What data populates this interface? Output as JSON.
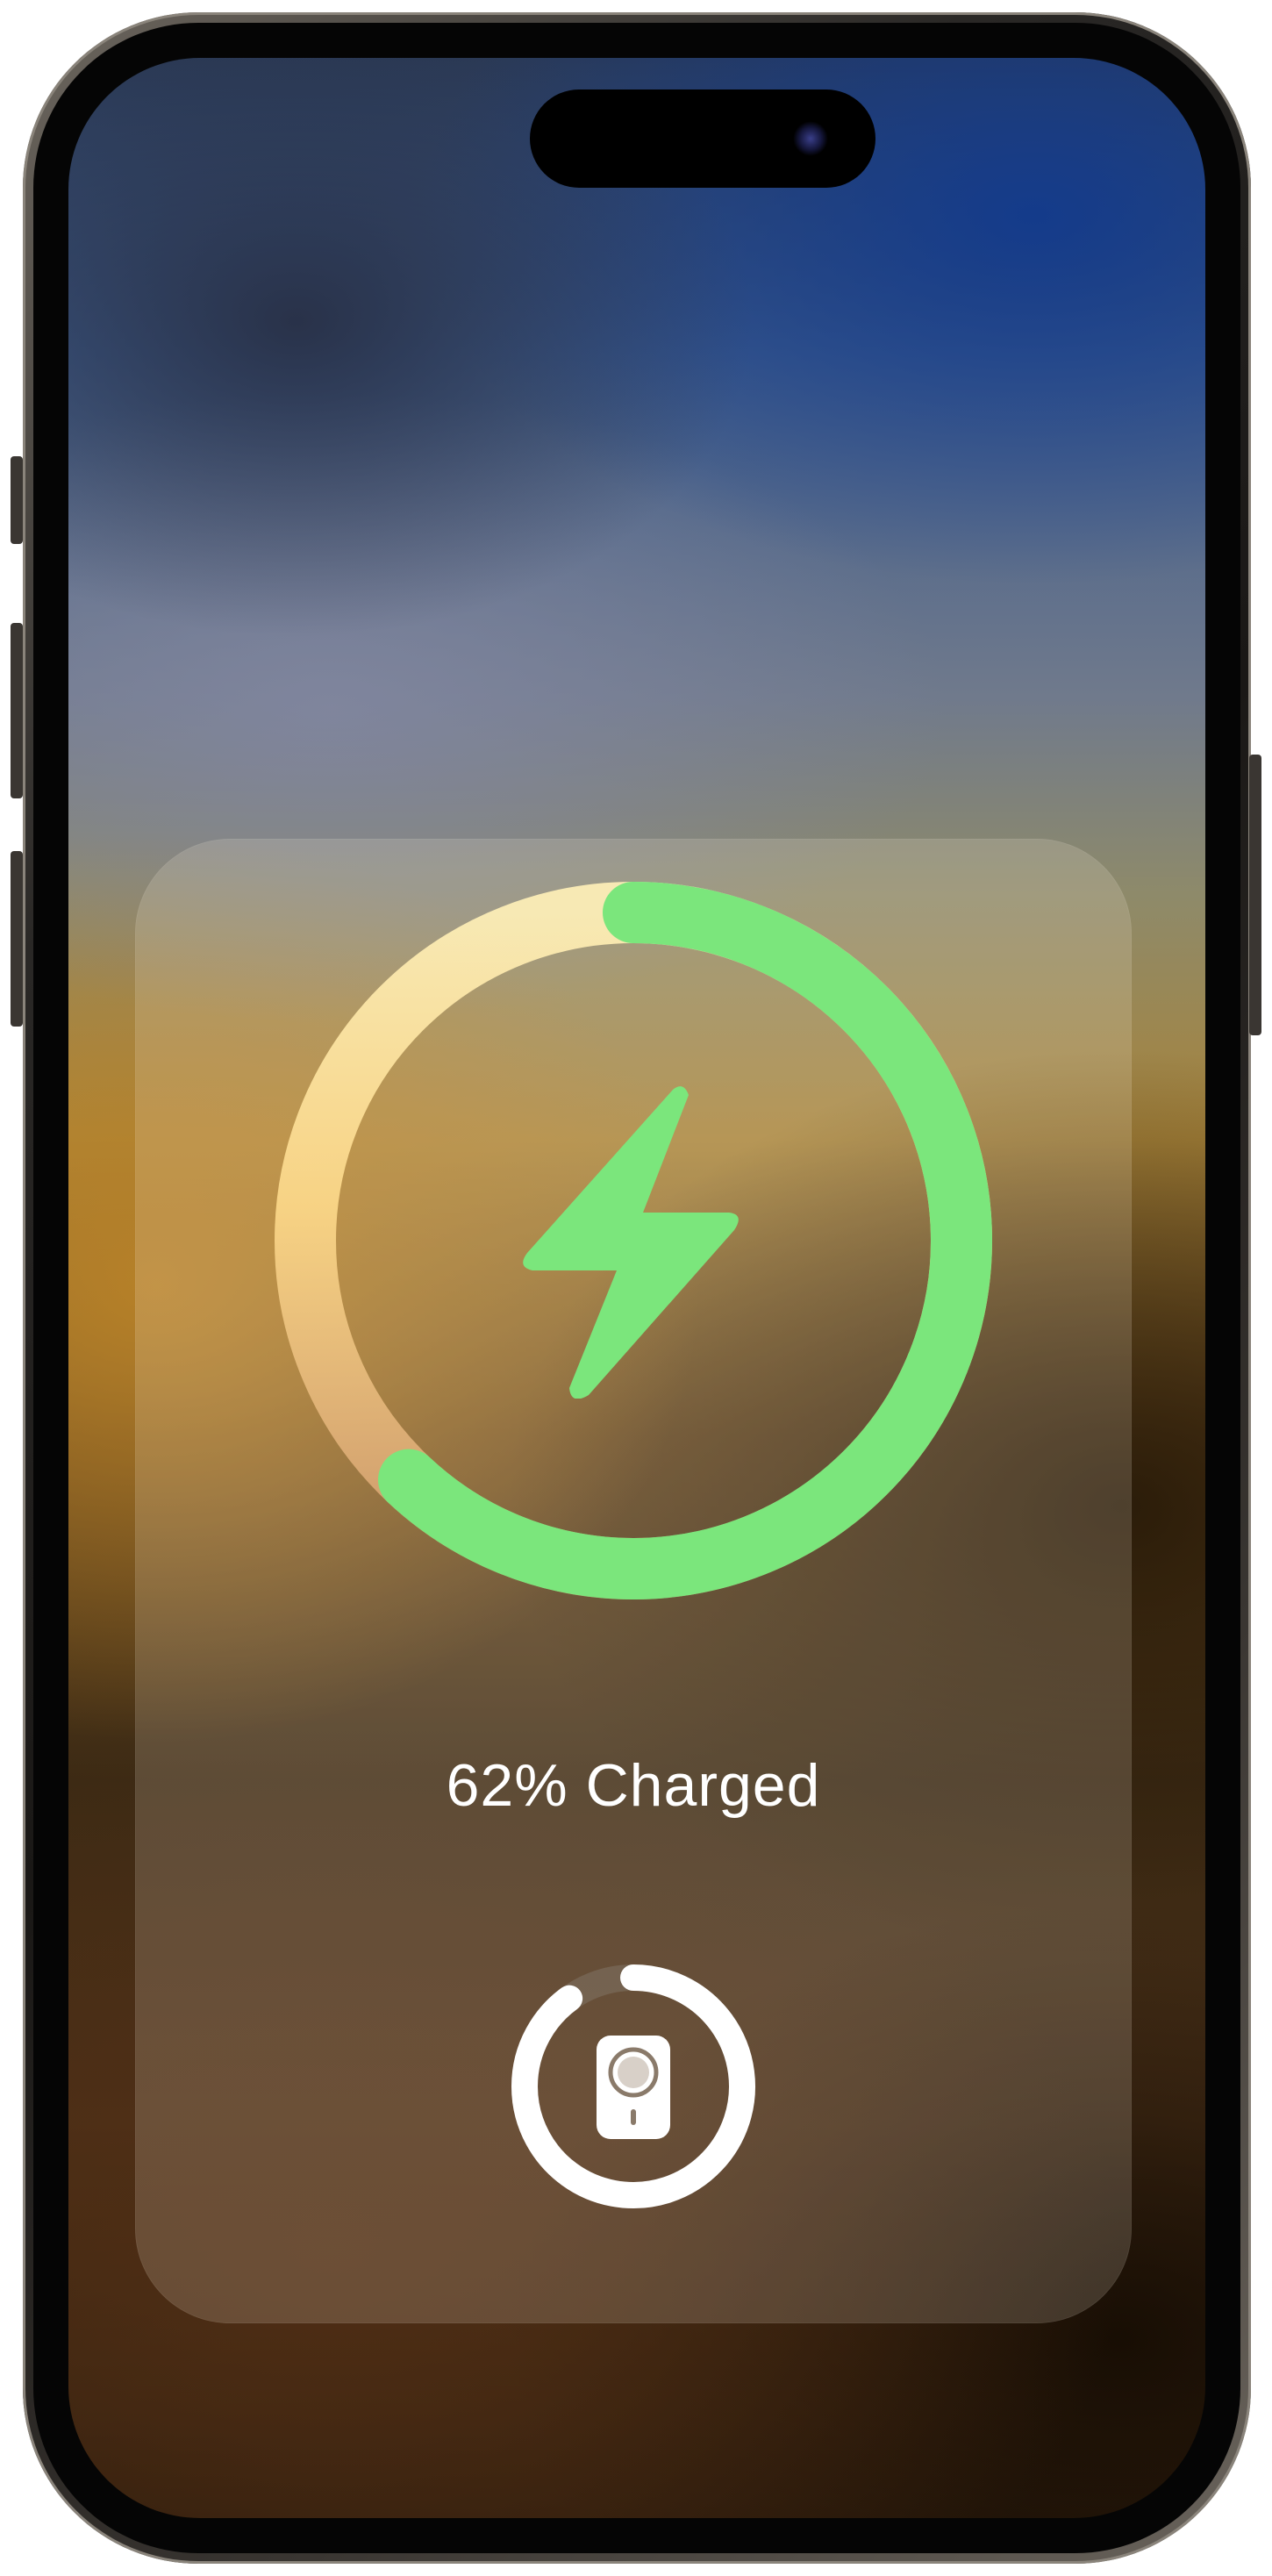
{
  "status": {
    "charge_percent": 62,
    "charge_label": "62% Charged",
    "charging": true
  },
  "accessory": {
    "name": "magsafe-battery-pack-icon",
    "charge_fraction": 0.9
  },
  "icons": {
    "main": "lightning-bolt-icon",
    "accessory": "magsafe-battery-pack-icon"
  },
  "colors": {
    "charge_green": "#7be67c",
    "ring_track_light": "#fde6a6",
    "ring_track_warm": "#d6a874",
    "accessory_ring": "#ffffff",
    "accessory_track": "#7a6a5a",
    "label_text": "#ffffff"
  }
}
